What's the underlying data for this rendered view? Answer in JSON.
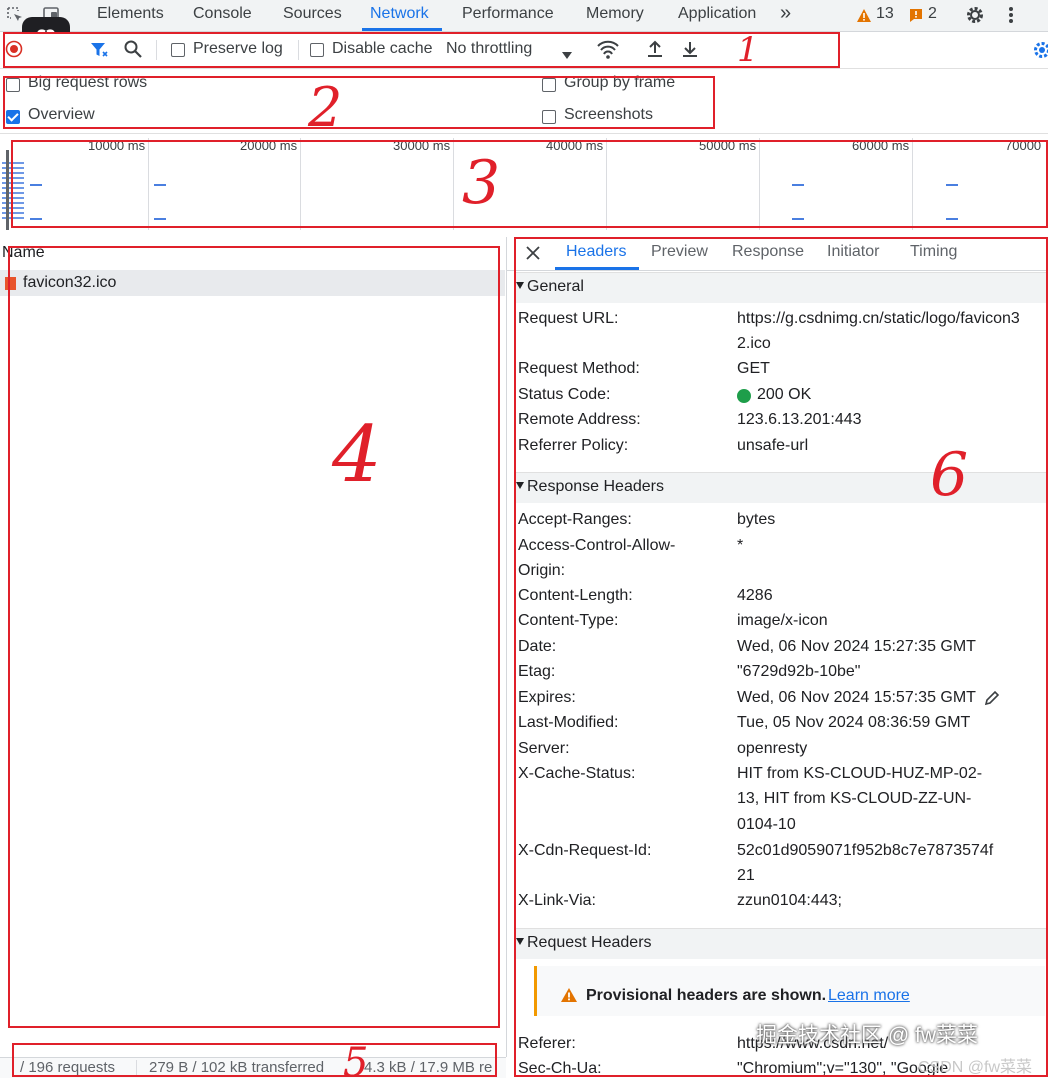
{
  "tabs": [
    "Elements",
    "Console",
    "Sources",
    "Network",
    "Performance",
    "Memory",
    "Application"
  ],
  "active_tab": "Network",
  "more_tabs": "»",
  "warnings_count": "13",
  "issues_count": "2",
  "toolbar": {
    "preserve_log": "Preserve log",
    "disable_cache": "Disable cache",
    "throttling": "No throttling"
  },
  "options": {
    "big_request_rows": "Big request rows",
    "overview": "Overview",
    "group_by_frame": "Group by frame",
    "screenshots": "Screenshots"
  },
  "timeline_ticks": [
    "10000 ms",
    "20000 ms",
    "30000 ms",
    "40000 ms",
    "50000 ms",
    "60000 ms",
    "70000"
  ],
  "annotations": [
    "1",
    "2",
    "3",
    "4",
    "5",
    "6"
  ],
  "request_list": {
    "column_header": "Name",
    "rows": [
      {
        "name": "favicon32.ico"
      }
    ]
  },
  "status_bar": {
    "requests": "/ 196 requests",
    "transferred": "279 B / 102 kB transferred",
    "resources": "4.3 kB / 17.9 MB re"
  },
  "details": {
    "tabs": [
      "Headers",
      "Preview",
      "Response",
      "Initiator",
      "Timing"
    ],
    "active_tab": "Headers",
    "general_title": "General",
    "general": [
      {
        "label": "Request URL:",
        "value": [
          "https://g.csdnimg.cn/static/logo/favicon3",
          "2.ico"
        ]
      },
      {
        "label": "Request Method:",
        "value": [
          "GET"
        ]
      },
      {
        "label": "Status Code:",
        "value": [
          "200 OK"
        ]
      },
      {
        "label": "Remote Address:",
        "value": [
          "123.6.13.201:443"
        ]
      },
      {
        "label": "Referrer Policy:",
        "value": [
          "unsafe-url"
        ]
      }
    ],
    "response_title": "Response Headers",
    "response": [
      {
        "label": [
          "Accept-Ranges:"
        ],
        "value": [
          "bytes"
        ]
      },
      {
        "label": [
          "Access-Control-Allow-",
          "Origin:"
        ],
        "value": [
          "*"
        ]
      },
      {
        "label": [
          "Content-Length:"
        ],
        "value": [
          "4286"
        ]
      },
      {
        "label": [
          "Content-Type:"
        ],
        "value": [
          "image/x-icon"
        ]
      },
      {
        "label": [
          "Date:"
        ],
        "value": [
          "Wed, 06 Nov 2024 15:27:35 GMT"
        ]
      },
      {
        "label": [
          "Etag:"
        ],
        "value": [
          "\"6729d92b-10be\""
        ]
      },
      {
        "label": [
          "Expires:"
        ],
        "value": [
          "Wed, 06 Nov 2024 15:57:35 GMT"
        ]
      },
      {
        "label": [
          "Last-Modified:"
        ],
        "value": [
          "Tue, 05 Nov 2024 08:36:59 GMT"
        ]
      },
      {
        "label": [
          "Server:"
        ],
        "value": [
          "openresty"
        ]
      },
      {
        "label": [
          "X-Cache-Status:"
        ],
        "value": [
          "HIT from KS-CLOUD-HUZ-MP-02-",
          "13, HIT from KS-CLOUD-ZZ-UN-",
          "0104-10"
        ]
      },
      {
        "label": [
          "X-Cdn-Request-Id:"
        ],
        "value": [
          "52c01d9059071f952b8c7e7873574f",
          "21"
        ]
      },
      {
        "label": [
          "X-Link-Via:"
        ],
        "value": [
          "zzun0104:443;"
        ]
      }
    ],
    "request_title": "Request Headers",
    "provisional_text": "Provisional headers are shown.",
    "learn_more": "Learn more",
    "request": [
      {
        "label": "Referer:",
        "value": "https://www.csdn.net/"
      },
      {
        "label": "Sec-Ch-Ua:",
        "value": "\"Chromium\";v=\"130\", \"Google"
      }
    ]
  },
  "watermark": "掘金技术社区 @ fw菜菜",
  "watermark2": "CSDN @fw菜菜",
  "colors": {
    "accent": "#1a73e8",
    "annotation": "#e0202a",
    "ok": "#1e9e4a",
    "warning": "#e37400"
  }
}
